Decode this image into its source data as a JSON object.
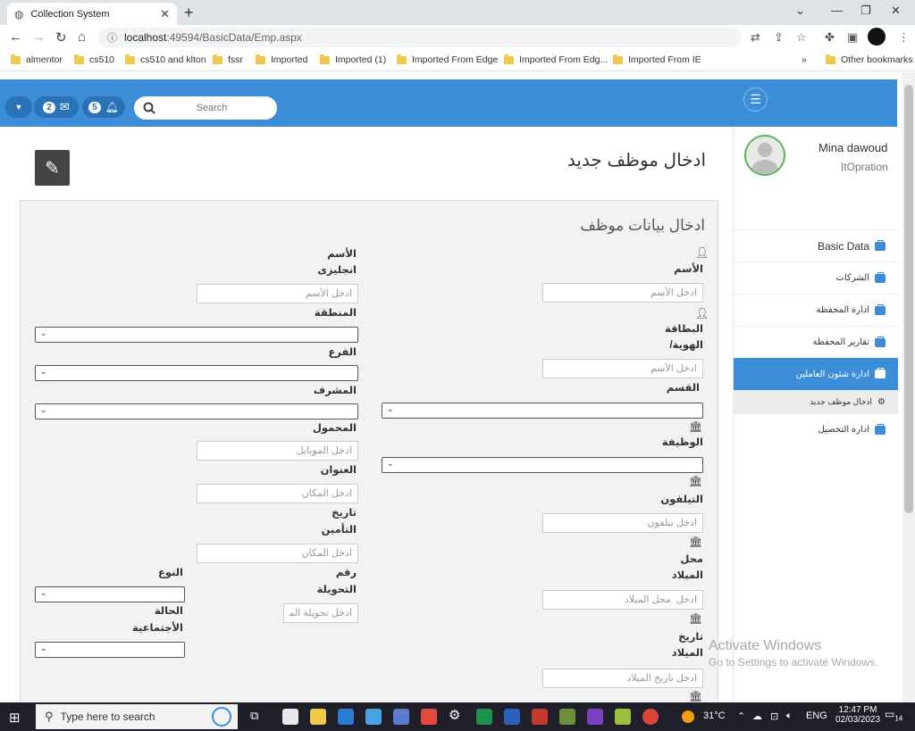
{
  "browser": {
    "tab_title": "Collection System",
    "url_host": "localhost",
    "url_rest": ":49594/BasicData/Emp.aspx",
    "bookmarks": [
      "almentor",
      "cs510",
      "cs510 and klton",
      "fssr",
      "Imported",
      "Imported (1)",
      "Imported From Edge",
      "Imported From Edg...",
      "Imported From IE"
    ],
    "other_bookmarks": "Other bookmarks",
    "more": "»"
  },
  "topnav": {
    "messages_count": "2",
    "notifications_count": "5",
    "search_placeholder": "Search"
  },
  "sidebar": {
    "user_name": "Mina dawoud",
    "user_role": "ItOpration",
    "items": [
      {
        "label": "Basic Data"
      },
      {
        "label": "الشركات"
      },
      {
        "label": "ادارة المحفظة"
      },
      {
        "label": "تقارير المحفظة"
      },
      {
        "label": "ادارة شئون العاملين"
      },
      {
        "label": "ادخال موظف جديد"
      },
      {
        "label": "ادارة التحصيل"
      }
    ]
  },
  "main": {
    "page_title": "ادخال موظف جديد",
    "panel_title": "ادخال بيانات موظف",
    "right_col": {
      "name_label": "الأسم",
      "name_placeholder": "ادخل الأسم",
      "card_label_1": "البطاقة",
      "card_label_2": "/الهوية",
      "card_placeholder": "ادخل الأسم",
      "dept_label": "القسم",
      "job_label": "الوظيفة",
      "phone_label": "التيلفون",
      "phone_placeholder": "ادخل تيلفون",
      "birthplace_label_1": "محل",
      "birthplace_label_2": "الميلاد",
      "birthplace_placeholder": "ادخل  محل الميلاد",
      "birthdate_label_1": "تاريخ",
      "birthdate_label_2": "الميلاد",
      "birthdate_placeholder": "ادخل تاريخ الميلاد"
    },
    "left_col": {
      "en_name_label_1": "الأسم",
      "en_name_label_2": "انجليزى",
      "en_name_placeholder": "ادخل الأسم",
      "region_label": "المنطقة",
      "branch_label": "الفرع",
      "supervisor_label": "المشرف",
      "mobile_label": "المحمول",
      "mobile_placeholder": "ادخل الموبايل",
      "address_label": "العنوان",
      "address_placeholder": "ادخل المكان",
      "insurance_label_1": "تاريخ",
      "insurance_label_2": "التأمين",
      "insurance_placeholder": "ادخل المكان",
      "transfer_label_1": "رقم",
      "transfer_label_2": "التحويلة",
      "transfer_placeholder": "ادخل تحويلة الموظ",
      "gender_label": "النوع",
      "marital_label_1": "الحالة",
      "marital_label_2": "الأجتماعية"
    }
  },
  "watermark": {
    "line1": "Activate Windows",
    "line2": "Go to Settings to activate Windows."
  },
  "taskbar": {
    "search_placeholder": "Type here to search",
    "weather": "31°C",
    "lang": "ENG",
    "time": "12:47 PM",
    "date": "02/03/2023",
    "notif_count": "14"
  }
}
